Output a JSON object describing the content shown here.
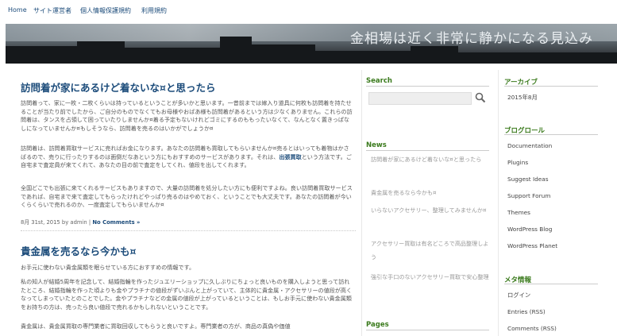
{
  "nav": {
    "items": [
      "Home",
      "サイト運営者",
      "個人情報保護規約",
      "利用規約"
    ]
  },
  "header": {
    "title": "金相場は近く非常に静かになる見込み"
  },
  "posts": [
    {
      "title": "訪問着が家にあるけど着ないな¤と思ったら",
      "paragraphs": [
        "訪問着って、家に一枚・二枚くらいは持っているということが多いかと思います。一昔前までは嫁入り道具に何枚も訪問着を持たせることが当たり前でしたから、ご自分のものでなくてもお母様やおばあ様も訪問着があるという方は少なくありません。これらの訪問着は、タンスを占領して困っていたりしませんか¤着る予定もないけれどゴミにするのももったいなくて、なんとなく置きっぱなしになっていませんか¤もしそうなら、訪問着を売るのはいかがでしょうか¤",
        "訪問着は、訪問着買取サービスに売ればお金になります。あなたの訪問着も買取してもらいませんか¤売るとはいっても着物はかさばるので、売りに行ったりするのは面倒だなあという方にもおすすめのサービスがあります。それは、",
        "という方法です。ご自宅まで査定員が来てくれて、あなたの目の前で査定をしてくれ、値段を出してくれます。",
        "全国どこでも出張に来てくれるサービスもありますので、大量の訪問着を処分したい方にも便利ですよね。良い訪問着買取サービスであれば、自宅まで来て査定してもらったけれどやっぱり売るのはやめておく、ということでも大丈夫です。あなたの訪問着が今いくらくらいで売れるのか、一度査定してもらいませんか¤"
      ],
      "keyword": "出張買取",
      "meta_date": "8月 31st, 2015 by admin",
      "meta_sep": "|",
      "comments_link": "No Comments »"
    },
    {
      "title": "貴金属を売るなら今かも¤",
      "paragraphs": [
        "お手元に使わない貴金属類を眠らせている方におすすめの情報です。",
        "私の知人が結婚5周年を記念して、結婚指輪を作ったジュエリーショップに久しぶりにちょっと良いものを購入しようと思って訪れたところ、結婚指輪を作った頃よりも金やプラチナの値段がずいぶんと上がっていて、主体的に貴金属・アクセサリーの値段が高くなってしまっていたとのことでした。金やプラチナなどの金属の値段が上がっているということは、もしお手元に使わない貴金属類をお持ちの方は、売ったら良い値段で売れるかもしれないということです。",
        "貴金属は、貴金属買取の専門業者に買取回収してもらうと良いですよ。専門業者の方が、商品の真偽や価値"
      ]
    }
  ],
  "sidebar1": {
    "search_title": "Search",
    "search_icon": "magnifier-icon",
    "news_title": "News",
    "news_items": [
      "訪問着が家にあるけど着ないな¤と思ったら",
      "貴金属を売るなら今かも¤",
      "いらないアクセサリー、整理してみませんか¤",
      "アクセサリー買取は有名どころで高品整理しよう",
      "強引な手口のないアクセサリー買取で安心整理"
    ],
    "pages_title": "Pages"
  },
  "sidebar2": {
    "archive_title": "アーカイブ",
    "archive_items": [
      "2015年8月"
    ],
    "blogroll_title": "ブログロール",
    "blogroll_items": [
      "Documentation",
      "Plugins",
      "Suggest Ideas",
      "Support Forum",
      "Themes",
      "WordPress Blog",
      "WordPress Planet"
    ],
    "meta_title": "メタ情報",
    "meta_items": [
      "ログイン",
      "Entries (RSS)",
      "Comments (RSS)"
    ]
  },
  "colors": {
    "link_blue": "#1b4b7a",
    "widget_green": "#3a7a1c"
  }
}
